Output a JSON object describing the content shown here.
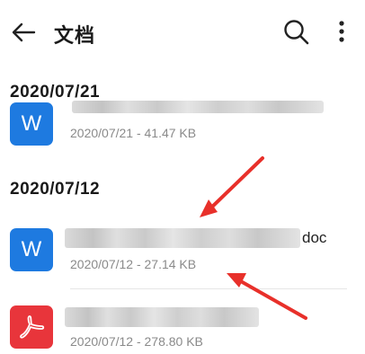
{
  "header": {
    "title": "文档",
    "back_icon": "arrow-left-icon",
    "search_icon": "search-icon",
    "more_icon": "more-vertical-icon"
  },
  "sections": [
    {
      "date": "2020/07/21",
      "items": [
        {
          "icon": "word-icon",
          "icon_letter": "W",
          "name": "",
          "meta": "2020/07/21 - 41.47 KB"
        }
      ]
    },
    {
      "date": "2020/07/12",
      "items": [
        {
          "icon": "word-icon",
          "icon_letter": "W",
          "name": "doc",
          "meta": "2020/07/12 - 27.14 KB"
        },
        {
          "icon": "pdf-icon",
          "icon_letter": "",
          "name": "",
          "meta": "2020/07/12 - 278.80 KB"
        }
      ]
    }
  ],
  "colors": {
    "word": "#1e7ae0",
    "pdf": "#e8353b",
    "arrow": "#e8302a"
  }
}
